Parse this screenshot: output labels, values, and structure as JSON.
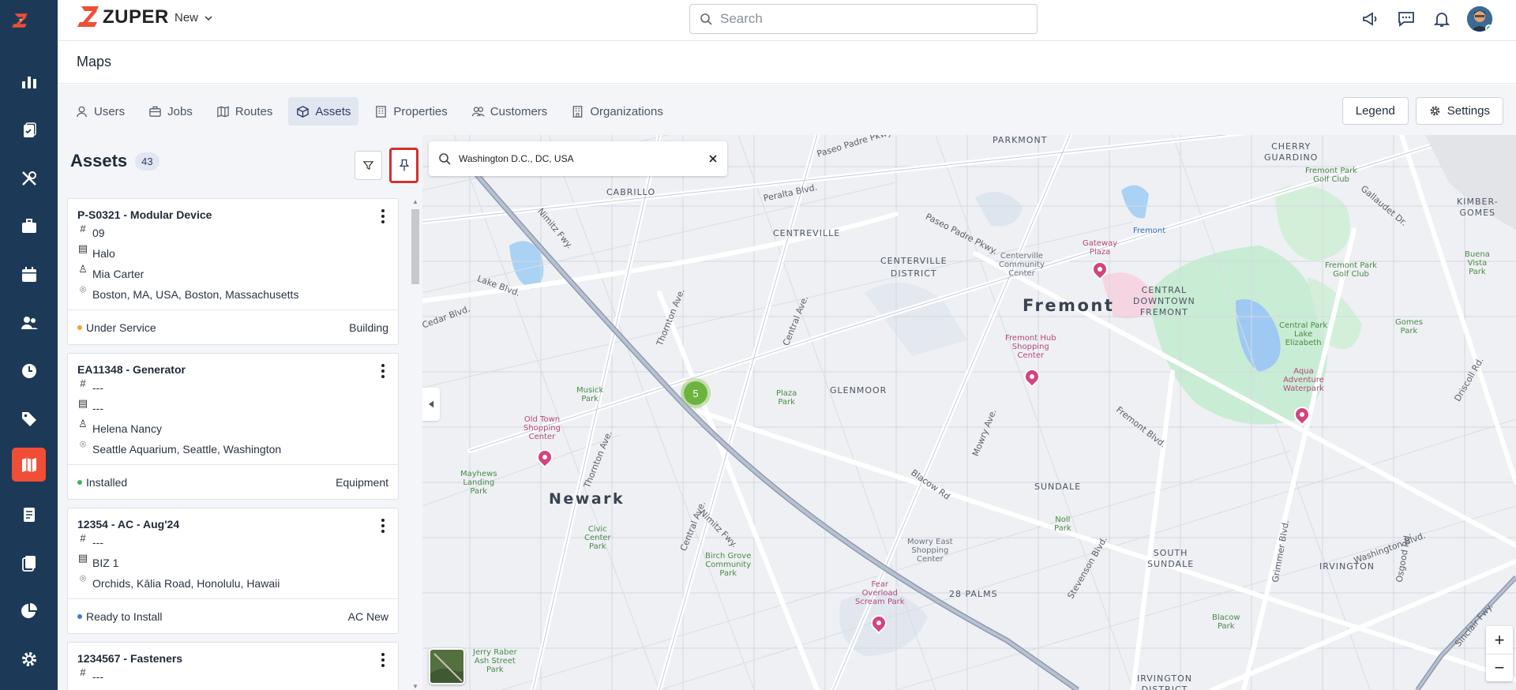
{
  "app": {
    "brand": "ZUPER",
    "new_label": "New",
    "search_placeholder": "Search",
    "page_title": "Maps"
  },
  "tabs": [
    {
      "label": "Users",
      "icon": "user-icon"
    },
    {
      "label": "Jobs",
      "icon": "briefcase-icon"
    },
    {
      "label": "Routes",
      "icon": "map-icon"
    },
    {
      "label": "Assets",
      "icon": "box-icon",
      "active": true
    },
    {
      "label": "Properties",
      "icon": "building-icon"
    },
    {
      "label": "Customers",
      "icon": "users-icon"
    },
    {
      "label": "Organizations",
      "icon": "office-icon"
    }
  ],
  "buttons": {
    "legend": "Legend",
    "settings": "Settings"
  },
  "panel": {
    "title": "Assets",
    "count": "43",
    "assets": [
      {
        "title": "P-S0321 - Modular Device",
        "number": "09",
        "org": "Halo",
        "owner": "Mia Carter",
        "address": "Boston, MA, USA, Boston, Massachusetts",
        "status": "Under Service",
        "status_color": "#f5a623",
        "category": "Building"
      },
      {
        "title": "EA11348 - Generator",
        "number": "---",
        "org": "---",
        "owner": "Helena Nancy",
        "address": "Seattle Aquarium, Seattle, Washington",
        "status": "Installed",
        "status_color": "#3cb55a",
        "category": "Equipment"
      },
      {
        "title": "12354 - AC - Aug'24",
        "number": "---",
        "org": "BIZ 1",
        "address": "Orchids, Kālia Road, Honolulu, Hawaii",
        "status": "Ready to Install",
        "status_color": "#3d7bd9",
        "category": "AC New"
      },
      {
        "title": "1234567 - Fasteners",
        "number": "---"
      }
    ]
  },
  "map": {
    "search_value": "Washington D.C., DC, USA",
    "cluster_count": "5",
    "zoom_in": "+",
    "zoom_out": "−",
    "labels": {
      "parkmont": "PARKMONT",
      "cherry_guardino": "CHERRY\nGUARDINO",
      "cabrillo": "CABRILLO",
      "centreville": "CENTREVILLE",
      "centerville_district": "CENTERVILLE\nDISTRICT",
      "kimber_gomes": "KIMBER-\nGOMES",
      "fremont": "Fremont",
      "central_downtown": "CENTRAL\nDOWNTOWN\nFREMONT",
      "glenmoor": "GLENMOOR",
      "newark": "Newark",
      "sundale": "SUNDALE",
      "south_sundale": "SOUTH\nSUNDALE",
      "irvington": "IRVINGTON",
      "palms": "28 PALMS",
      "irvington_district": "IRVINGTON\nDISTRICT"
    },
    "pois": {
      "gateway": "Gateway\nPlaza",
      "hub": "Fremont Hub\nShopping\nCenter",
      "oldtown": "Old Town\nShopping\nCenter",
      "aqua": "Aqua\nAdventure\nWaterpark",
      "fear": "Fear\nOverload\nScream Park",
      "centerville_cc": "Centerville\nCommunity\nCenter",
      "fremont_store": "Fremont",
      "mowry": "Mowry East\nShopping\nCenter"
    },
    "parks": {
      "golf1": "Fremont Park\nGolf Club",
      "golf2": "Fremont Park\nGolf Club",
      "lake": "Central Park\nLake\nElizabeth",
      "gomes": "Gomes\nPark",
      "buena": "Buena\nVista\nPark",
      "musick": "Musick\nPark",
      "plaza": "Plaza\nPark",
      "mayhews": "Mayhews\nLanding\nPark",
      "civic": "Civic\nCenter\nPark",
      "birch": "Birch Grove\nCommunity\nPark",
      "noll": "Noll\nPark",
      "jerry": "Jerry Raber\nAsh Street\nPark",
      "blacow": "Blacow\nPark"
    },
    "roads": {
      "paseo1": "Paseo Padre Pkwy.",
      "peralta": "Peralta Blvd.",
      "paseo2": "Paseo Padre Pkwy.",
      "lake_blvd": "Lake Blvd.",
      "nimitz": "Nimitz Fwy.",
      "thornton": "Thornton Ave.",
      "central": "Central Ave.",
      "cedar": "Cedar Blvd.",
      "blacow": "Blacow Rd",
      "mowry": "Mowry Ave.",
      "fremont_blvd": "Fremont Blvd.",
      "washington": "Washington Blvd.",
      "stevenson": "Stevenson Blvd.",
      "grimmer": "Grimmer Blvd.",
      "osgood": "Osgood Rd.",
      "gallaudet": "Gallaudet Dr.",
      "driscoll": "Driscoll Rd.",
      "sinclair": "Sinclair Fwy."
    }
  }
}
